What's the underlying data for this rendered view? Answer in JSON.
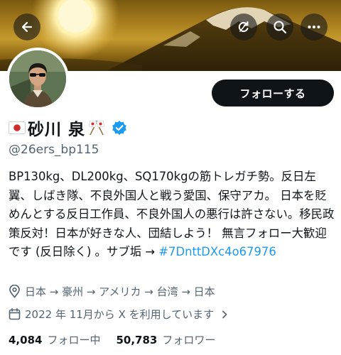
{
  "header": {
    "back_icon": "arrow-left-icon",
    "refresh_icon": "refresh-icon",
    "search_icon": "search-icon",
    "more_icon": "more-horizontal-icon"
  },
  "profile": {
    "display_name": "砂川 泉",
    "handle": "@26ers_bp115",
    "follow_label": "フォローする",
    "bio_text": "BP130kg、DL200kg、SQ170kgの筋トレガチ勢。反日左翼、しばき隊、不良外国人と戦う愛国、保守アカ。 日本を貶めんとする反日工作員、不良外国人の悪行は許さない。移民政策反対！日本が好きな人、団結しよう！ 無言フォロー大歓迎です (反日除く) 。サブ垢 → ",
    "bio_tag": "#7DnttDXc4o67976",
    "location": "日本 → 豪州 → アメリカ → 台湾 → 日本",
    "joined": "2022 年 11月から X を利用しています",
    "following_count": "4,084",
    "following_label": "フォロー中",
    "followers_count": "50,783",
    "followers_label": "フォロワー"
  },
  "colors": {
    "text_primary": "#0f1419",
    "text_secondary": "#536471",
    "link": "#1d9bf0",
    "verified": "#1d9bf0",
    "button_bg": "#0f1419"
  }
}
